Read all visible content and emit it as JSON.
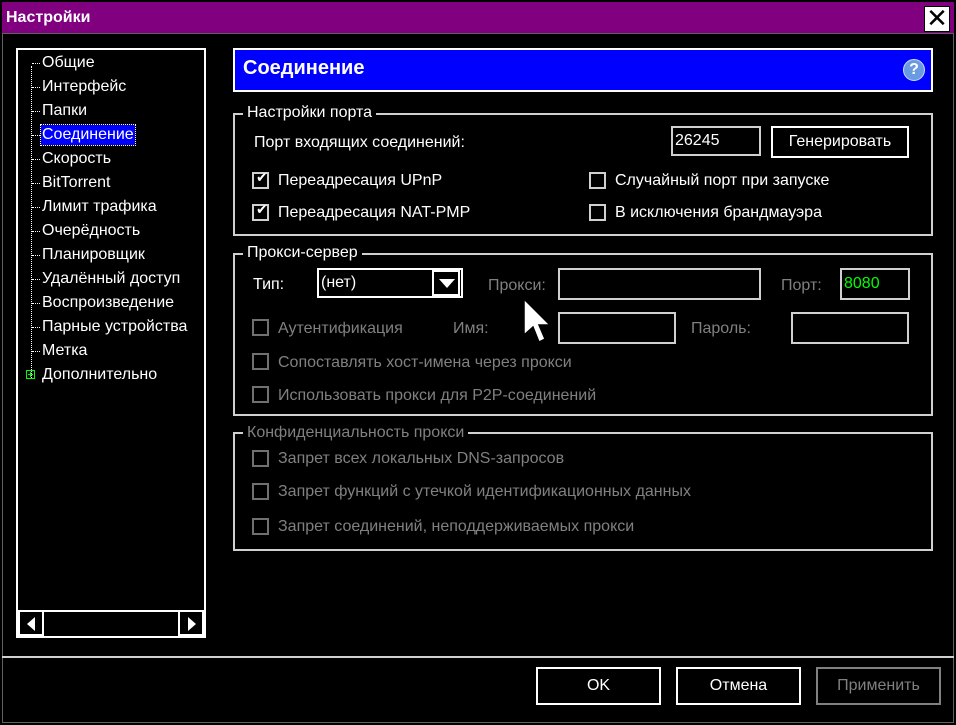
{
  "window": {
    "title": "Настройки"
  },
  "tree": {
    "items": [
      {
        "label": "Общие"
      },
      {
        "label": "Интерфейс"
      },
      {
        "label": "Папки"
      },
      {
        "label": "Соединение",
        "selected": true
      },
      {
        "label": "Скорость"
      },
      {
        "label": "BitTorrent"
      },
      {
        "label": "Лимит трафика"
      },
      {
        "label": "Очерёдность"
      },
      {
        "label": "Планировщик"
      },
      {
        "label": "Удалённый доступ"
      },
      {
        "label": "Воспроизведение"
      },
      {
        "label": "Парные устройства"
      },
      {
        "label": "Метка"
      },
      {
        "label": "Дополнительно",
        "expandable": true
      }
    ]
  },
  "header": {
    "title": "Соединение",
    "help_icon": "help-icon"
  },
  "port_settings": {
    "legend": "Настройки порта",
    "incoming_port_label": "Порт входящих соединений:",
    "incoming_port_value": "26245",
    "generate_label": "Генерировать",
    "upnp_label": "Переадресация UPnP",
    "upnp_checked": true,
    "natpmp_label": "Переадресация NAT-PMP",
    "natpmp_checked": true,
    "random_port_label": "Случайный порт при запуске",
    "random_port_checked": false,
    "firewall_label": "В исключения брандмауэра",
    "firewall_checked": false
  },
  "proxy": {
    "legend": "Прокси-сервер",
    "type_label": "Тип:",
    "type_value": "(нет)",
    "proxy_label": "Прокси:",
    "proxy_value": "",
    "port_label": "Порт:",
    "port_value": "8080",
    "port_value_color": "#00ff00",
    "auth_label": "Аутентификация",
    "name_label": "Имя:",
    "password_label": "Пароль:",
    "resolve_label": "Сопоставлять хост-имена через прокси",
    "p2p_label": "Использовать прокси для P2P-соединений"
  },
  "privacy": {
    "legend": "Конфиденциальность прокси",
    "dns_label": "Запрет всех локальных DNS-запросов",
    "leak_label": "Запрет функций с утечкой идентификационных данных",
    "unsupported_label": "Запрет соединений, неподдерживаемых прокси"
  },
  "footer": {
    "ok_label": "OK",
    "cancel_label": "Отмена",
    "apply_label": "Применить"
  },
  "colors": {
    "titlebar": "#800080",
    "header": "#0000ff",
    "selection": "#0000ff",
    "background": "#000000"
  }
}
